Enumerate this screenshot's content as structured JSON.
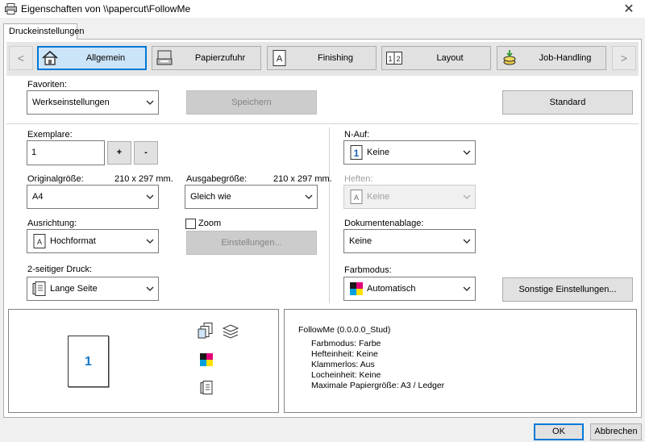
{
  "window": {
    "title": "Eigenschaften von \\\\papercut\\FollowMe",
    "close_glyph": "✕"
  },
  "tabs": [
    {
      "label": "Druckeinstellungen"
    }
  ],
  "categories": [
    {
      "label": "Allgemein",
      "icon": "home-icon"
    },
    {
      "label": "Papierzufuhr",
      "icon": "printer-tray-icon"
    },
    {
      "label": "Finishing",
      "icon": "finishing-icon"
    },
    {
      "label": "Layout",
      "icon": "layout-icon"
    },
    {
      "label": "Job-Handling",
      "icon": "job-handling-icon"
    }
  ],
  "nav": {
    "prev": "<",
    "next": ">"
  },
  "favorites": {
    "label": "Favoriten:",
    "value": "Werkseinstellungen",
    "save_label": "Speichern",
    "standard_label": "Standard"
  },
  "copies": {
    "label": "Exemplare:",
    "value": "1",
    "plus": "+",
    "minus": "-"
  },
  "original_size": {
    "label": "Originalgröße:",
    "dims": "210 x 297 mm.",
    "value": "A4"
  },
  "output_size": {
    "label": "Ausgabegröße:",
    "dims": "210 x 297 mm.",
    "value": "Gleich wie"
  },
  "orientation": {
    "label": "Ausrichtung:",
    "value": "Hochformat"
  },
  "zoom": {
    "label": "Zoom",
    "settings_label": "Einstellungen..."
  },
  "duplex": {
    "label": "2-seitiger Druck:",
    "value": "Lange Seite"
  },
  "n_up": {
    "label": "N-Auf:",
    "value": "Keine"
  },
  "staple": {
    "label": "Heften:",
    "value": "Keine"
  },
  "document_filing": {
    "label": "Dokumentenablage:",
    "value": "Keine"
  },
  "color_mode": {
    "label": "Farbmodus:",
    "value": "Automatisch",
    "other_settings_label": "Sonstige Einstellungen..."
  },
  "preview": {
    "page_number": "1"
  },
  "info": {
    "heading": "FollowMe (0.0.0.0_Stud)",
    "lines": [
      "Farbmodus: Farbe",
      "Hefteinheit: Keine",
      "Klammerlos: Aus",
      "Locheinheit: Keine",
      "Maximale Papiergröße: A3 / Ledger"
    ]
  },
  "footer": {
    "ok_label": "OK",
    "cancel_label": "Abbrechen"
  }
}
